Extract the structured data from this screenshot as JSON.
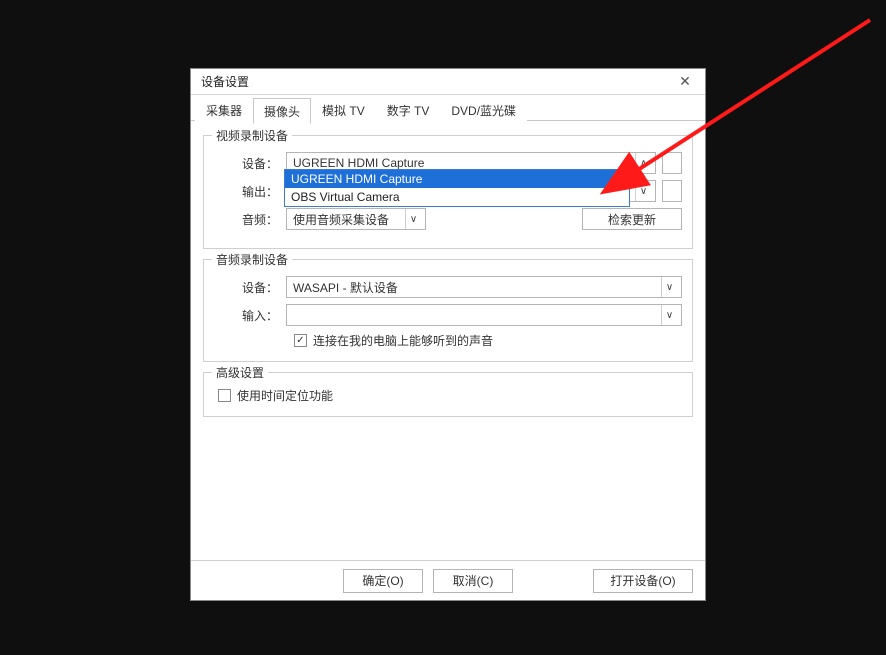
{
  "dialog": {
    "title": "设备设置"
  },
  "tabs": {
    "t0": "采集器",
    "t1": "摄像头",
    "t2": "模拟 TV",
    "t3": "数字 TV",
    "t4": "DVD/蓝光碟"
  },
  "video": {
    "group_title": "视频录制设备",
    "device_label": "设备：",
    "device_value": "UGREEN HDMI Capture",
    "output_label": "输出：",
    "audio_label": "音频：",
    "audio_value": "使用音频采集设备",
    "update_btn": "检索更新",
    "dropdown": {
      "opt0": "UGREEN HDMI Capture",
      "opt1": "OBS Virtual Camera"
    }
  },
  "audio": {
    "group_title": "音频录制设备",
    "device_label": "设备：",
    "device_value": "WASAPI - 默认设备",
    "input_label": "输入：",
    "input_value": "",
    "checkbox_label": "连接在我的电脑上能够听到的声音"
  },
  "advanced": {
    "group_title": "高级设置",
    "checkbox_label": "使用时间定位功能"
  },
  "footer": {
    "ok": "确定(O)",
    "cancel": "取消(C)",
    "open": "打开设备(O)"
  }
}
